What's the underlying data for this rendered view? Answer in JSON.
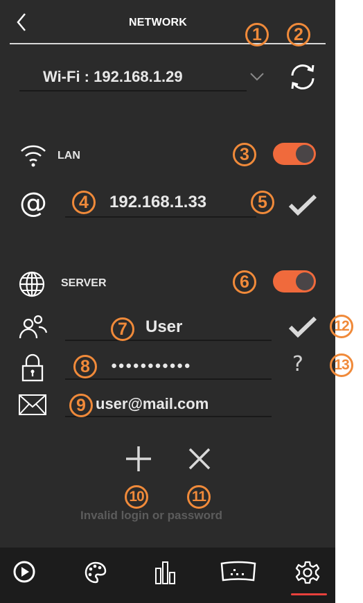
{
  "header": {
    "title": "NETWORK"
  },
  "wifi": {
    "label": "Wi-Fi : 192.168.1.29"
  },
  "lan": {
    "label": "LAN",
    "ip": "192.168.1.33",
    "enabled": true
  },
  "server": {
    "label": "SERVER",
    "enabled": true,
    "user": "User",
    "password": "●●●●●●●●●●●",
    "email": "user@mail.com",
    "help": "?",
    "error": "Invalid login or password"
  },
  "callouts": [
    "1",
    "2",
    "3",
    "4",
    "5",
    "6",
    "7",
    "8",
    "9",
    "10",
    "11",
    "12",
    "13"
  ],
  "colors": {
    "accent": "#f06a3c",
    "callout": "#f08a3a",
    "background": "#2b2b2b",
    "navbar": "#1c1c1c"
  },
  "icons": [
    "back-icon",
    "dropdown-chevron-icon",
    "refresh-icon",
    "wifi-icon",
    "at-icon",
    "check-icon",
    "globe-icon",
    "users-icon",
    "lock-icon",
    "mail-icon",
    "plus-icon",
    "close-icon",
    "play-icon",
    "palette-icon",
    "equalizer-icon",
    "display-icon",
    "settings-icon"
  ]
}
